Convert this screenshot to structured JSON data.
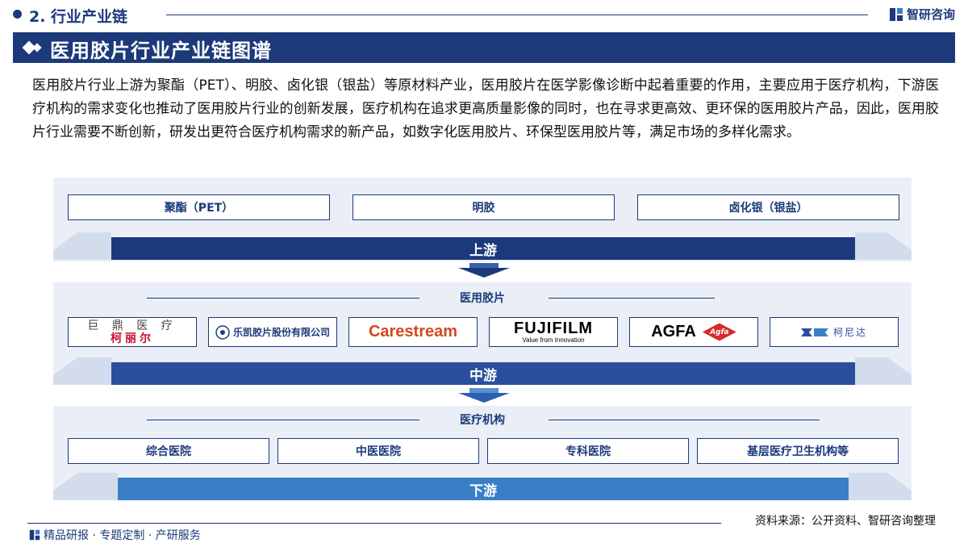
{
  "header": {
    "section_label": "2. 行业产业链",
    "brand": "智研咨询"
  },
  "title": "医用胶片行业产业链图谱",
  "intro": "医用胶片行业上游为聚酯（PET）、明胶、卤化银（银盐）等原材料产业，医用胶片在医学影像诊断中起着重要的作用，主要应用于医疗机构，下游医疗机构的需求变化也推动了医用胶片行业的创新发展，医疗机构在追求更高质量影像的同时，也在寻求更高效、更环保的医用胶片产品，因此，医用胶片行业需要不断创新，研发出更符合医疗机构需求的新产品，如数字化医用胶片、环保型医用胶片等，满足市场的多样化需求。",
  "upstream": {
    "band_label": "上游",
    "items": [
      "聚酯（PET）",
      "明胶",
      "卤化银（银盐）"
    ]
  },
  "midstream": {
    "band_label": "中游",
    "section_label": "医用胶片",
    "logos": [
      {
        "line1": "巨 鼎 医 疗",
        "line2": "柯丽尔"
      },
      {
        "text": "乐凯胶片股份有限公司"
      },
      {
        "text": "Carestream"
      },
      {
        "text": "FUJIFILM",
        "sub": "Value from Innovation"
      },
      {
        "text": "AGFA",
        "mark": "Agfa"
      },
      {
        "text": "柯尼达"
      }
    ]
  },
  "downstream": {
    "band_label": "下游",
    "section_label": "医疗机构",
    "items": [
      "综合医院",
      "中医医院",
      "专科医院",
      "基层医疗卫生机构等"
    ]
  },
  "footer": {
    "source": "资料来源：公开资料、智研咨询整理",
    "tagline": "精品研报 · 专题定制 · 产研服务"
  },
  "colors": {
    "primary": "#1c3a7a",
    "band_mid": "#2a4f9e",
    "band_low": "#3a7fc6",
    "tier_bg": "#e9eef7",
    "carestream": "#d14a1f",
    "agfa_red": "#d62b2b"
  }
}
